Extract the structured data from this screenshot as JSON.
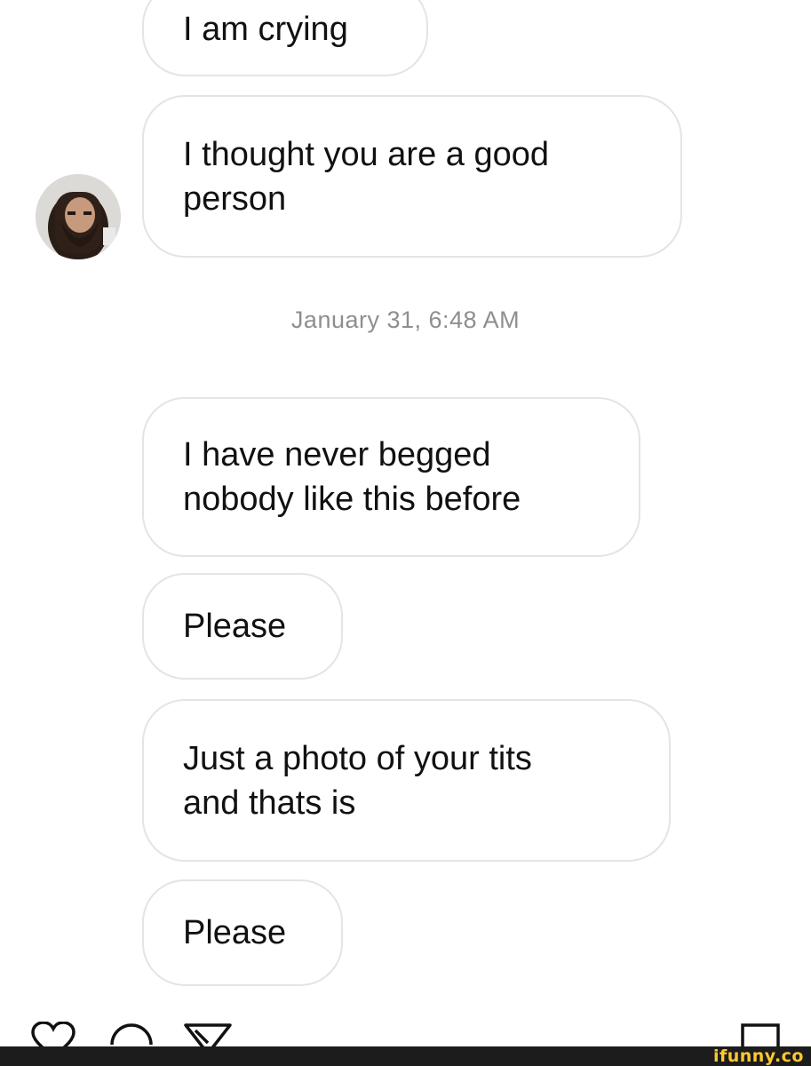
{
  "conversation": {
    "messages": [
      {
        "lines": [
          "I am crying"
        ]
      },
      {
        "lines": [
          "I thought you are a good",
          "person"
        ]
      },
      {
        "lines": [
          "I have never begged",
          "nobody like this before"
        ]
      },
      {
        "lines": [
          "Please"
        ]
      },
      {
        "lines": [
          "Just a photo of your tits",
          "and thats is"
        ]
      },
      {
        "lines": [
          "Please"
        ]
      }
    ],
    "timestamp": "January 31, 6:48 AM"
  },
  "actions": {
    "icons": [
      "heart-icon",
      "comment-icon",
      "send-icon",
      "bookmark-icon"
    ]
  },
  "watermark": {
    "text": "ifunny.co",
    "color": "#ffc833"
  }
}
